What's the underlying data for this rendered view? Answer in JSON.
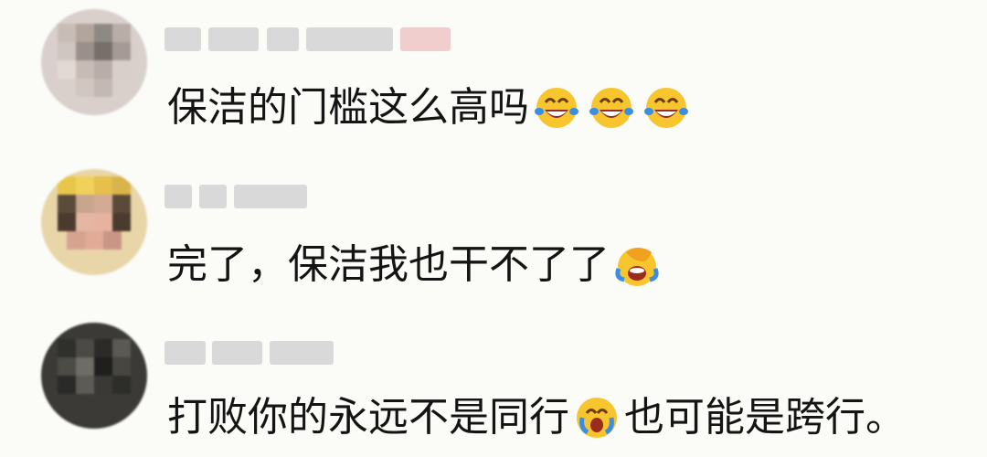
{
  "comments": [
    {
      "username": "",
      "text_parts": [
        "保洁的门槛这么高吗"
      ],
      "emojis_after": [
        "laughing-crying-emoji",
        "laughing-crying-emoji",
        "laughing-crying-emoji"
      ]
    },
    {
      "username": "",
      "text_parts": [
        "完了，保洁我也干不了了"
      ],
      "emojis_after": [
        "facepalm-laugh-emoji"
      ]
    },
    {
      "username": "",
      "text_parts": [
        "打败你的永远不是同行",
        "也可能是跨行。"
      ],
      "emojis_mid": [
        "crying-emoji"
      ]
    }
  ],
  "colors": {
    "background": "#fbfbf8",
    "text": "#141414",
    "emoji_yellow": "#f7c52d",
    "tear_blue": "#3a8ee6"
  }
}
